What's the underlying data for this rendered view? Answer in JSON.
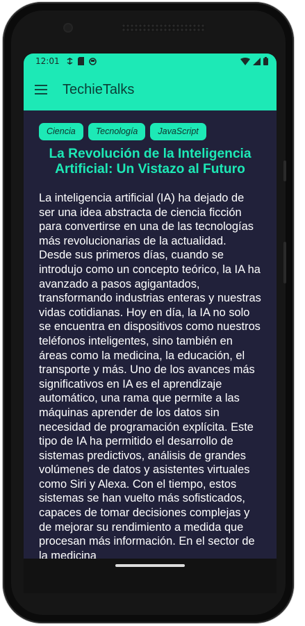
{
  "status": {
    "time": "12:01",
    "left_icons": [
      "debug-icon",
      "sim-card-icon",
      "app-notification-icon"
    ],
    "right_icons": [
      "wifi-icon",
      "signal-icon",
      "battery-icon"
    ]
  },
  "appbar": {
    "title": "TechieTalks",
    "menu_icon": "hamburger-menu-icon"
  },
  "tags": [
    "Ciencia",
    "Tecnología",
    "JavaScript"
  ],
  "article": {
    "title": "La Revolución de la Inteligencia Artificial: Un Vistazo al Futuro",
    "body": "La inteligencia artificial (IA) ha dejado de ser una idea abstracta de ciencia ficción para convertirse en una de las tecnologías más revolucionarias de la actualidad. Desde sus primeros días, cuando se introdujo como un concepto teórico, la IA ha avanzado a pasos agigantados, transformando industrias enteras y nuestras vidas cotidianas. Hoy en día, la IA no solo se encuentra en dispositivos como nuestros teléfonos inteligentes, sino también en áreas como la medicina, la educación, el transporte y más. Uno de los avances más significativos en IA es el aprendizaje automático, una rama que permite a las máquinas aprender de los datos sin necesidad de programación explícita. Este tipo de IA ha permitido el desarrollo de sistemas predictivos, análisis de grandes volúmenes de datos y asistentes virtuales como Siri y Alexa. Con el tiempo, estos sistemas se han vuelto más sofisticados, capaces de tomar decisiones complejas y de mejorar su rendimiento a medida que procesan más información. En el sector de la medicina"
  },
  "colors": {
    "accent": "#1de9b6",
    "background": "#21213a",
    "text": "#ffffff",
    "device_frame": "#0b0b0b"
  }
}
